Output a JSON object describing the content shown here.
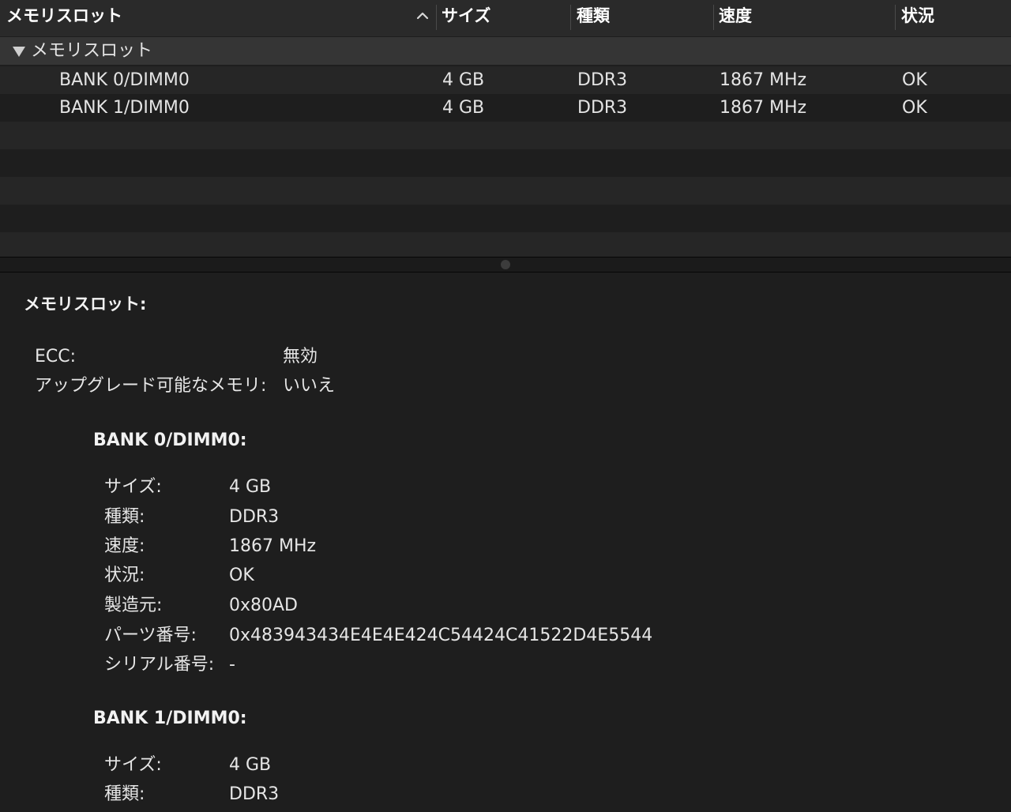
{
  "table": {
    "columns": [
      "メモリスロット",
      "サイズ",
      "種類",
      "速度",
      "状況"
    ],
    "group_label": "メモリスロット",
    "rows": [
      {
        "name": "BANK 0/DIMM0",
        "size": "4 GB",
        "type": "DDR3",
        "speed": "1867 MHz",
        "status": "OK"
      },
      {
        "name": "BANK 1/DIMM0",
        "size": "4 GB",
        "type": "DDR3",
        "speed": "1867 MHz",
        "status": "OK"
      }
    ]
  },
  "detail": {
    "title": "メモリスロット:",
    "fields": [
      {
        "label": "ECC:",
        "value": "無効"
      },
      {
        "label": "アップグレード可能なメモリ:",
        "value": "いいえ"
      }
    ],
    "banks": [
      {
        "title": "BANK 0/DIMM0:",
        "fields": [
          {
            "label": "サイズ:",
            "value": "4 GB"
          },
          {
            "label": "種類:",
            "value": "DDR3"
          },
          {
            "label": "速度:",
            "value": "1867 MHz"
          },
          {
            "label": "状況:",
            "value": "OK"
          },
          {
            "label": "製造元:",
            "value": "0x80AD"
          },
          {
            "label": "パーツ番号:",
            "value": "0x483943434E4E4E424C54424C41522D4E5544"
          },
          {
            "label": "シリアル番号:",
            "value": "-"
          }
        ]
      },
      {
        "title": "BANK 1/DIMM0:",
        "fields": [
          {
            "label": "サイズ:",
            "value": "4 GB"
          },
          {
            "label": "種類:",
            "value": "DDR3"
          }
        ]
      }
    ]
  },
  "colors": {
    "background": "#1e1e1e",
    "header": "#2a2a2a",
    "group_row": "#353535",
    "stripe": "#262626",
    "text": "#e6e6e6"
  },
  "icons": {
    "sort": "chevron-up-icon",
    "disclosure": "triangle-down-icon",
    "splitter": "splitter-handle-icon"
  }
}
